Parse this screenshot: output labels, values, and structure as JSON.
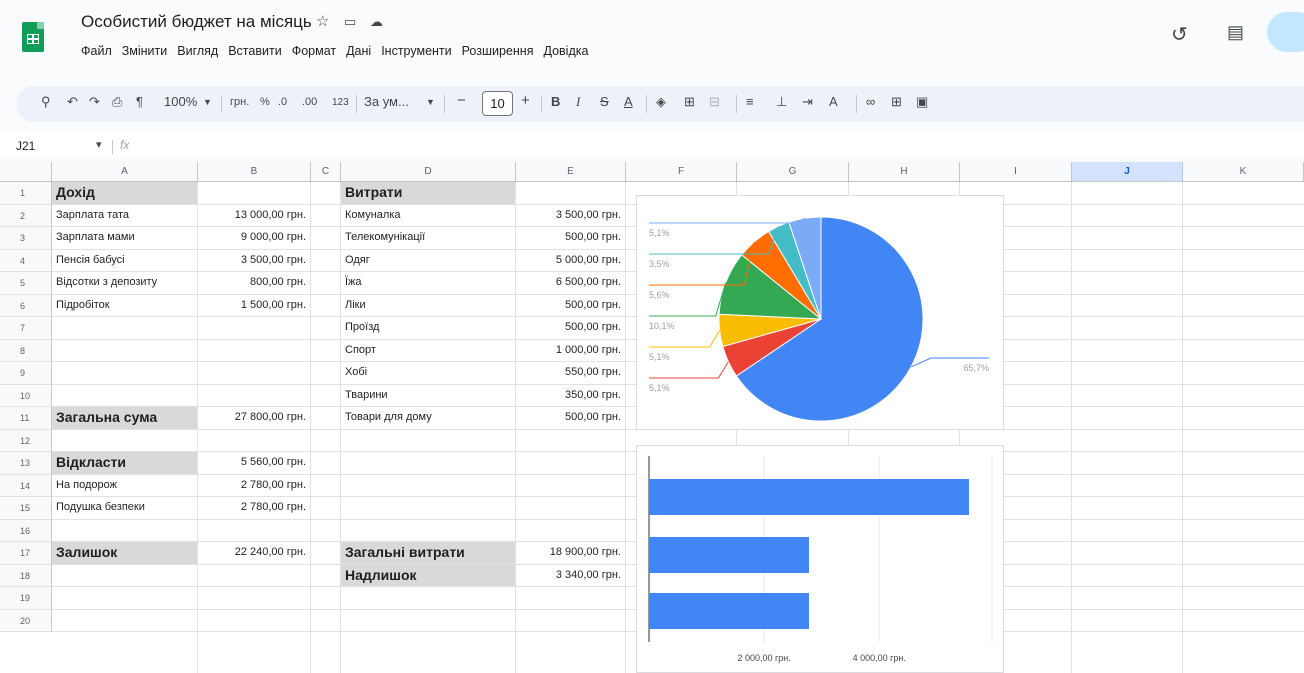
{
  "doc": {
    "title": "Особистий бюджет на місяць",
    "title_icons": [
      "star-icon",
      "move-folder-icon",
      "cloud-status-icon"
    ]
  },
  "menu": [
    "Файл",
    "Змінити",
    "Вигляд",
    "Вставити",
    "Формат",
    "Дані",
    "Інструменти",
    "Розширення",
    "Довідка"
  ],
  "topright_icons": [
    "history-icon",
    "comments-icon",
    "share-icon"
  ],
  "toolbar": {
    "zoom": "100%",
    "currency": "грн.",
    "percent": "%",
    "decrease_decimal": ".0",
    "increase_decimal": ".00",
    "number_format": "123",
    "font": "За ум...",
    "font_size": "10",
    "minus": "−",
    "plus": "+",
    "bold": "B",
    "italic": "I",
    "strike": "S",
    "text_color": "A"
  },
  "formula_bar": {
    "cell_ref": "J21",
    "fx": "fx",
    "value": ""
  },
  "columns": [
    "A",
    "B",
    "C",
    "D",
    "E",
    "F",
    "G",
    "H",
    "I",
    "J",
    "K"
  ],
  "selected_column": "J",
  "rows": [
    "1",
    "2",
    "3",
    "4",
    "5",
    "6",
    "7",
    "8",
    "9",
    "10",
    "11",
    "12",
    "13",
    "14",
    "15",
    "16",
    "17",
    "18",
    "19",
    "20"
  ],
  "income": {
    "header": "Дохід",
    "items": [
      {
        "label": "Зарплата тата",
        "value": "13 000,00 грн."
      },
      {
        "label": "Зарплата мами",
        "value": "9 000,00 грн."
      },
      {
        "label": "Пенсія бабусі",
        "value": "3 500,00 грн."
      },
      {
        "label": "Відсотки з депозиту",
        "value": "800,00 грн."
      },
      {
        "label": "Підробіток",
        "value": "1 500,00 грн."
      }
    ],
    "total_label": "Загальна сума",
    "total_value": "27 800,00 грн."
  },
  "saving": {
    "header": "Відкласти",
    "header_value": "5 560,00 грн.",
    "items": [
      {
        "label": "На подорож",
        "value": "2 780,00 грн."
      },
      {
        "label": "Подушка безпеки",
        "value": "2 780,00 грн."
      }
    ]
  },
  "remainder": {
    "label": "Залишок",
    "value": "22 240,00 грн."
  },
  "expenses": {
    "header": "Витрати",
    "items": [
      {
        "label": "Комуналка",
        "value": "3 500,00 грн."
      },
      {
        "label": "Телекомунікації",
        "value": "500,00 грн."
      },
      {
        "label": "Одяг",
        "value": "5 000,00 грн."
      },
      {
        "label": "Їжа",
        "value": "6 500,00 грн."
      },
      {
        "label": "Ліки",
        "value": "500,00 грн."
      },
      {
        "label": "Проїзд",
        "value": "500,00 грн."
      },
      {
        "label": "Спорт",
        "value": "1 000,00 грн."
      },
      {
        "label": "Хобі",
        "value": "550,00 грн."
      },
      {
        "label": "Тварини",
        "value": "350,00 грн."
      },
      {
        "label": "Товари для дому",
        "value": "500,00 грн."
      }
    ],
    "total_label": "Загальні витрати",
    "total_value": "18 900,00 грн.",
    "surplus_label": "Надлишок",
    "surplus_value": "3 340,00 грн."
  },
  "chart_data": [
    {
      "type": "pie",
      "slices": [
        {
          "value": 65.7,
          "label": "65,7%",
          "color": "#4285f4"
        },
        {
          "value": 5.1,
          "label": "5,1%",
          "color": "#ea4335"
        },
        {
          "value": 5.1,
          "label": "5,1%",
          "color": "#fbbc04"
        },
        {
          "value": 10.1,
          "label": "10,1%",
          "color": "#34a853"
        },
        {
          "value": 5.6,
          "label": "5,6%",
          "color": "#ff6d01"
        },
        {
          "value": 3.5,
          "label": "3,5%",
          "color": "#46bdc6"
        },
        {
          "value": 5.1,
          "label": "5,1%",
          "color": "#7baaf7"
        }
      ]
    },
    {
      "type": "bar",
      "orientation": "horizontal",
      "values": [
        5560,
        2780,
        2780
      ],
      "color": "#4285f4",
      "xlim": [
        0,
        5560
      ],
      "ticks": [
        {
          "value": 2000,
          "label": "2 000,00 грн."
        },
        {
          "value": 4000,
          "label": "4 000,00 грн."
        }
      ]
    }
  ]
}
